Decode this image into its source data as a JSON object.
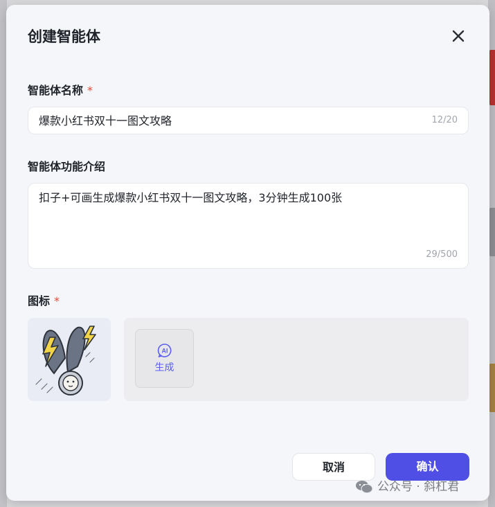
{
  "modal": {
    "title": "创建智能体",
    "close_icon": "close-icon"
  },
  "name_field": {
    "label": "智能体名称",
    "required_mark": "*",
    "value": "爆款小红书双十一图文攻略",
    "counter": "12/20"
  },
  "description_field": {
    "label": "智能体功能介绍",
    "value": "扣子+可画生成爆款小红书双十一图文攻略，3分钟生成100张",
    "counter": "29/500"
  },
  "icon_field": {
    "label": "图标",
    "required_mark": "*",
    "preview_icon": "lightning-rabbit-avatar-icon",
    "ai_generate": {
      "icon": "ai-sparkle-icon",
      "icon_text": "AI",
      "label": "生成"
    }
  },
  "footer": {
    "cancel_label": "取消",
    "confirm_label": "确认"
  },
  "watermark": {
    "icon": "wechat-logo-icon",
    "text": "公众号 · 斜杠君"
  },
  "colors": {
    "primary": "#4f4fe6",
    "required": "#e5483b",
    "modal_bg": "#f5f6f9",
    "ai_accent": "#5a5ff0"
  }
}
